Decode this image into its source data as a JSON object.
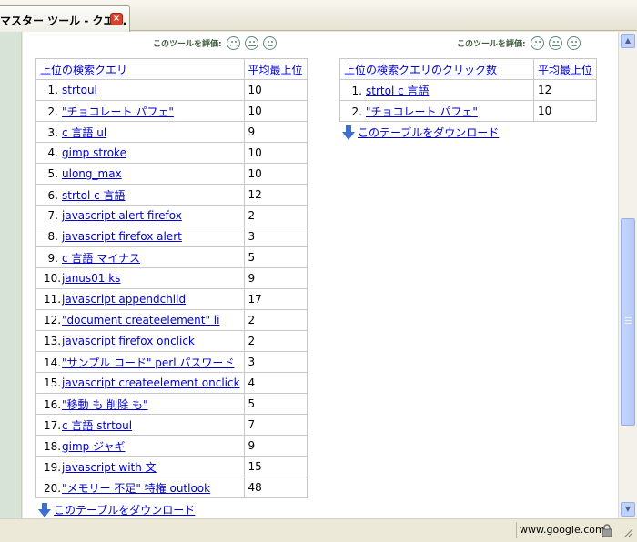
{
  "tab": {
    "title": "マスター ツール - クエ..."
  },
  "rating": {
    "label": "このツールを評価:"
  },
  "left_table": {
    "col_query": "上位の検索クエリ",
    "col_pos": "平均最上位",
    "rows": [
      {
        "idx": "1.",
        "query": "strtoul",
        "pos": "10"
      },
      {
        "idx": "2.",
        "query": "\"チョコレート パフェ\"",
        "pos": "10"
      },
      {
        "idx": "3.",
        "query": "c 言語 ul",
        "pos": "9"
      },
      {
        "idx": "4.",
        "query": "gimp stroke",
        "pos": "10"
      },
      {
        "idx": "5.",
        "query": "ulong_max",
        "pos": "10"
      },
      {
        "idx": "6.",
        "query": "strtol c 言語",
        "pos": "12"
      },
      {
        "idx": "7.",
        "query": "javascript alert firefox",
        "pos": "2"
      },
      {
        "idx": "8.",
        "query": "javascript firefox alert",
        "pos": "3"
      },
      {
        "idx": "9.",
        "query": "c 言語 マイナス",
        "pos": "5"
      },
      {
        "idx": "10.",
        "query": "janus01 ks",
        "pos": "9"
      },
      {
        "idx": "11.",
        "query": "javascript appendchild",
        "pos": "17"
      },
      {
        "idx": "12.",
        "query": "\"document createelement\" li",
        "pos": "2"
      },
      {
        "idx": "13.",
        "query": "javascript firefox onclick",
        "pos": "2"
      },
      {
        "idx": "14.",
        "query": "\"サンプル コード\" perl パスワード",
        "pos": "3"
      },
      {
        "idx": "15.",
        "query": "javascript createelement onclick",
        "pos": "4"
      },
      {
        "idx": "16.",
        "query": "\"移動 も 削除 も\"",
        "pos": "5"
      },
      {
        "idx": "17.",
        "query": "c 言語 strtoul",
        "pos": "7"
      },
      {
        "idx": "18.",
        "query": "gimp ジャギ",
        "pos": "9"
      },
      {
        "idx": "19.",
        "query": "javascript with 文",
        "pos": "15"
      },
      {
        "idx": "20.",
        "query": "\"メモリー 不足\" 特権 outlook",
        "pos": "48"
      }
    ],
    "download": "このテーブルをダウンロード"
  },
  "right_table": {
    "col_query": "上位の検索クエリのクリック数",
    "col_pos": "平均最上位",
    "rows": [
      {
        "idx": "1.",
        "query": "strtol c 言語",
        "pos": "12"
      },
      {
        "idx": "2.",
        "query": "\"チョコレート パフェ\"",
        "pos": "10"
      }
    ],
    "download": "このテーブルをダウンロード"
  },
  "status": {
    "host": "www.google.com"
  },
  "colors": {
    "link": "#0000cc",
    "sidebar": "#d6e3d6",
    "close": "#d9412b"
  }
}
